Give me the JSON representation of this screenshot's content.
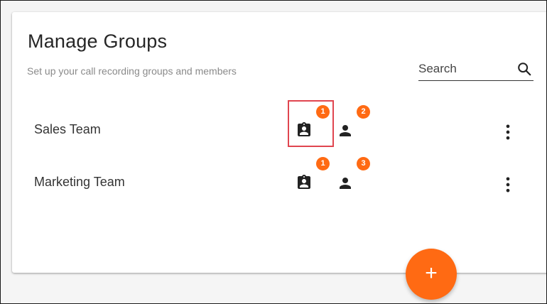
{
  "header": {
    "title": "Manage Groups",
    "subtitle": "Set up your call recording groups and members"
  },
  "search": {
    "label": "Search",
    "icon": "search-icon"
  },
  "groups": [
    {
      "name": "Sales Team",
      "recorders_count": "1",
      "members_count": "2",
      "recorder_icon": "clipboard-user-icon",
      "member_icon": "person-icon",
      "menu_icon": "more-vert-icon"
    },
    {
      "name": "Marketing Team",
      "recorders_count": "1",
      "members_count": "3",
      "recorder_icon": "clipboard-user-icon",
      "member_icon": "person-icon",
      "menu_icon": "more-vert-icon"
    }
  ],
  "fab": {
    "label": "+"
  },
  "colors": {
    "accent": "#ff6a13",
    "highlight": "#e0454f",
    "text_primary": "#262626",
    "text_secondary": "#8a8a8a"
  }
}
